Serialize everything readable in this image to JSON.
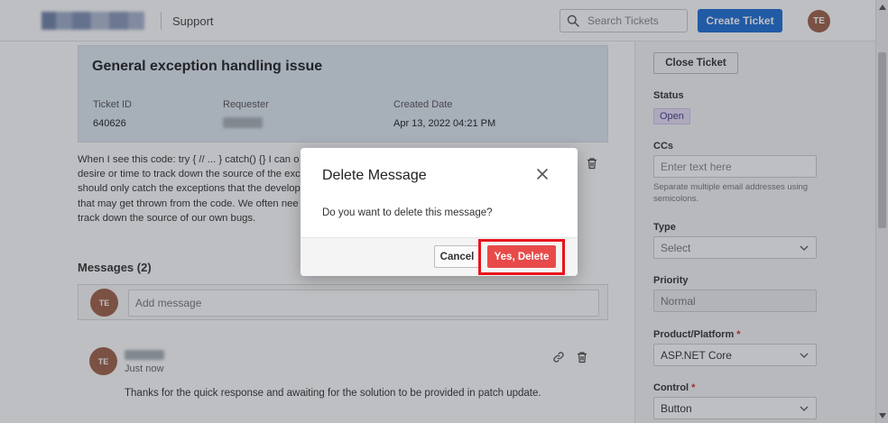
{
  "header": {
    "section_link": "Support",
    "search_placeholder": "Search Tickets",
    "create_button": "Create Ticket",
    "user_initials": "TE"
  },
  "ticket": {
    "title": "General exception handling issue",
    "id_label": "Ticket ID",
    "id_value": "640626",
    "requester_label": "Requester",
    "created_label": "Created Date",
    "created_value": "Apr 13, 2022 04:21 PM",
    "description_lines": [
      "When I see this code: try { // ... } catch() {} I can o",
      "desire or time to track down the source of the exc",
      "should only catch the exceptions that the develop",
      "that may get thrown from the code. We often nee",
      "track down the source of our own bugs."
    ]
  },
  "messages": {
    "title": "Messages (2)",
    "compose_placeholder": "Add message",
    "compose_initials": "TE",
    "items": [
      {
        "initials": "TE",
        "time": "Just now",
        "body": "Thanks for the quick response and awaiting for the solution to be provided in patch update."
      }
    ]
  },
  "sidebar": {
    "close_button": "Close Ticket",
    "status_label": "Status",
    "status_value": "Open",
    "ccs_label": "CCs",
    "ccs_placeholder": "Enter text here",
    "ccs_help": "Separate multiple email addresses using semicolons.",
    "type_label": "Type",
    "type_value": "Select",
    "priority_label": "Priority",
    "priority_value": "Normal",
    "product_label": "Product/Platform",
    "product_value": "ASP.NET Core",
    "control_label": "Control",
    "control_value": "Button",
    "required_mark": "*"
  },
  "modal": {
    "title": "Delete Message",
    "text": "Do you want to delete this message?",
    "cancel": "Cancel",
    "confirm": "Yes, Delete"
  },
  "colors": {
    "primary": "#1f6fd6",
    "danger": "#e84a4a",
    "highlight": "#e8141c",
    "avatar": "#a0624a"
  }
}
